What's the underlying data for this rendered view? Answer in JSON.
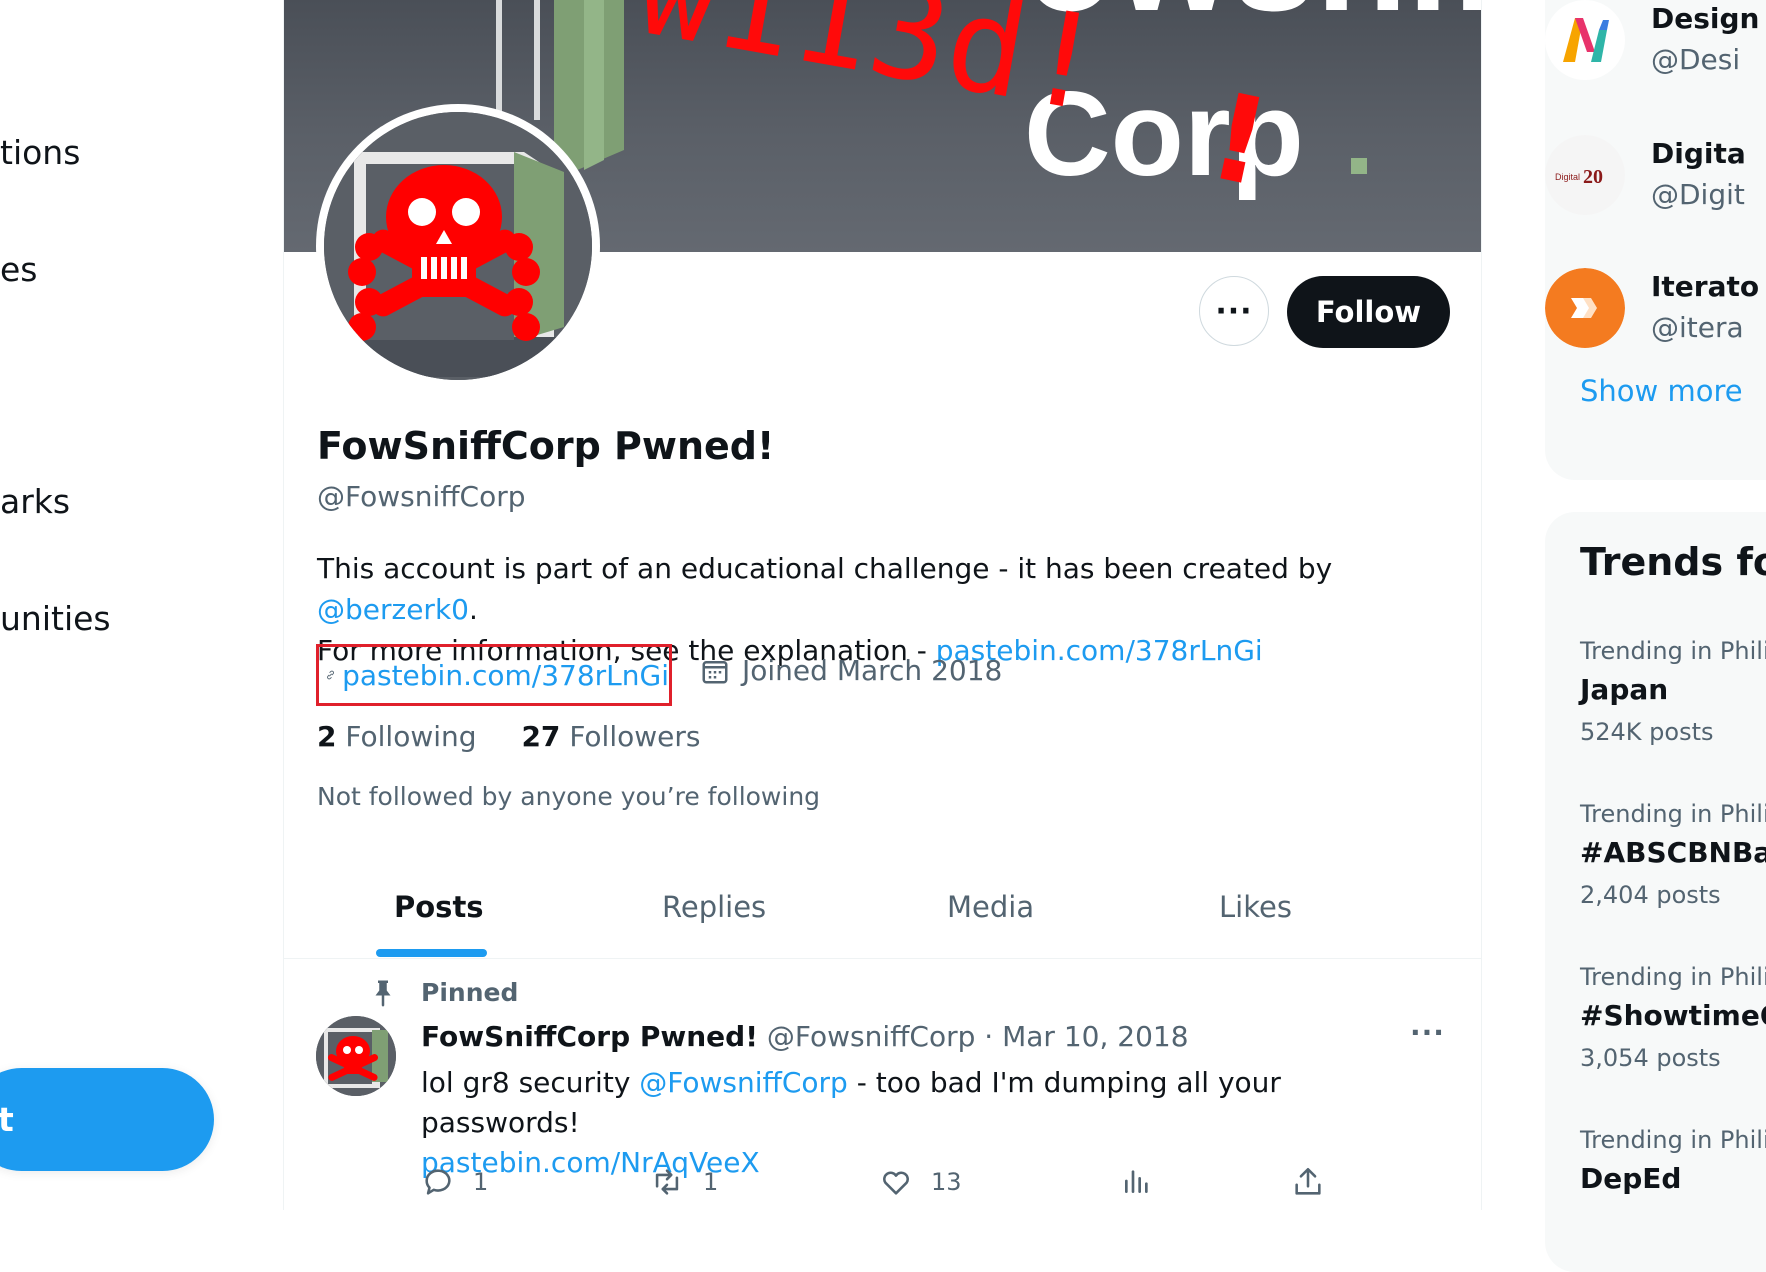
{
  "left_nav": {
    "items": [
      "tions",
      "es",
      "arks",
      "unities"
    ],
    "post_button": "t"
  },
  "profile": {
    "banner_text_top": "owsniff",
    "banner_text_bottom": "Corp",
    "banner_graffiti": "w113d!",
    "name": "FowSniffCorp Pwned!",
    "handle": "@FowsniffCorp",
    "more_label": "···",
    "follow_label": "Follow",
    "bio_text_1": "This account is part of an educational challenge - it has been created by ",
    "bio_mention": "@berzerk0",
    "bio_text_2": ".",
    "bio_text_3": "For more information, see the explanation - ",
    "bio_link": "pastebin.com/378rLnGi",
    "website": "pastebin.com/378rLnGi",
    "joined": "Joined March 2018",
    "following_count": "2",
    "following_label": "Following",
    "followers_count": "27",
    "followers_label": "Followers",
    "not_followed": "Not followed by anyone you’re following"
  },
  "tabs": [
    "Posts",
    "Replies",
    "Media",
    "Likes"
  ],
  "pinned_tweet": {
    "pinned_label": "Pinned",
    "name": "FowSniffCorp Pwned!",
    "meta": " @FowsniffCorp · Mar 10, 2018",
    "more_label": "···",
    "text_1": "lol gr8 security ",
    "mention": "@FowsniffCorp",
    "text_2": " - too bad I'm dumping all your passwords!",
    "link": "pastebin.com/NrAqVeeX",
    "replies": "1",
    "retweets": "1",
    "likes": "13"
  },
  "who_to_follow": {
    "accounts": [
      {
        "name": "Design",
        "handle": "@Desi",
        "icon": "design-logo-icon"
      },
      {
        "name": "Digita",
        "handle": "@Digit",
        "icon": "digital-20-logo-icon"
      },
      {
        "name": "Iterato",
        "handle": "@itera",
        "icon": "iterato-logo-icon"
      }
    ],
    "show_more": "Show more"
  },
  "trends": {
    "title": "Trends fo",
    "items": [
      {
        "context": "Trending in Philip",
        "topic": "Japan",
        "posts": "524K posts"
      },
      {
        "context": "Trending in Philip",
        "topic": "#ABSCBNBall",
        "posts": "2,404 posts"
      },
      {
        "context": "Trending in Philip",
        "topic": "#ShowtimeOA",
        "posts": "3,054 posts"
      },
      {
        "context": "Trending in Philip",
        "topic": "DepEd",
        "posts": ""
      }
    ]
  },
  "colors": {
    "accent": "#1d9bf0",
    "text": "#0f1419",
    "muted": "#536471",
    "highlight_box": "#e0202b",
    "skull": "#ff0000"
  }
}
